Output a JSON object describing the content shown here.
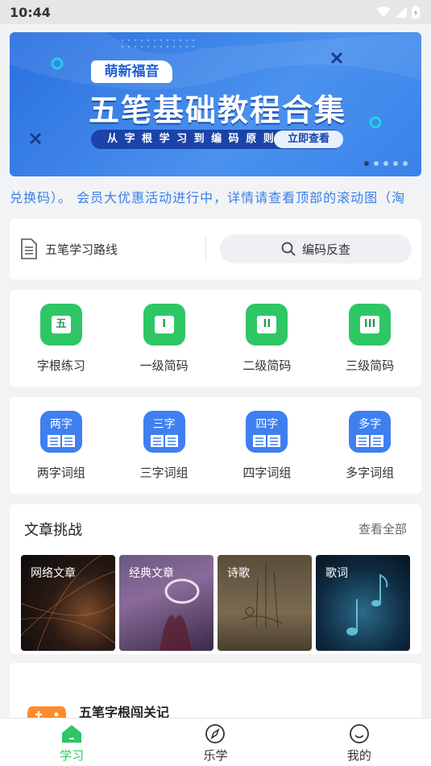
{
  "status_bar": {
    "time": "10:44"
  },
  "banner": {
    "tag": "萌新福音",
    "title": "五笔基础教程合集",
    "subtitle": "从 字 根 学 习 到 编 码 原 则",
    "button": "立即查看"
  },
  "marquee": {
    "text": "兑换码）。  会员大优惠活动进行中，详情请查看顶部的滚动图（淘"
  },
  "route": {
    "label": "五笔学习路线",
    "search_label": "编码反查"
  },
  "grid1": [
    {
      "label": "字根练习",
      "glyph": "五"
    },
    {
      "label": "一级简码",
      "glyph": "I"
    },
    {
      "label": "二级简码",
      "glyph": "II"
    },
    {
      "label": "三级简码",
      "glyph": "III"
    }
  ],
  "grid2": [
    {
      "label": "两字词组",
      "glyph": "两字"
    },
    {
      "label": "三字词组",
      "glyph": "三字"
    },
    {
      "label": "四字词组",
      "glyph": "四字"
    },
    {
      "label": "多字词组",
      "glyph": "多字"
    }
  ],
  "articles": {
    "title": "文章挑战",
    "more": "查看全部",
    "items": [
      {
        "label": "网络文章"
      },
      {
        "label": "经典文章"
      },
      {
        "label": "诗歌"
      },
      {
        "label": "歌词"
      }
    ]
  },
  "game": {
    "title": "五笔字根闯关记"
  },
  "nav": [
    {
      "label": "学习",
      "icon": "home-icon",
      "active": true
    },
    {
      "label": "乐学",
      "icon": "compass-icon",
      "active": false
    },
    {
      "label": "我的",
      "icon": "smile-icon",
      "active": false
    }
  ],
  "colors": {
    "accent_green": "#2fc666",
    "accent_blue": "#3a7ee8",
    "banner_blue": "#2a6fe0"
  }
}
